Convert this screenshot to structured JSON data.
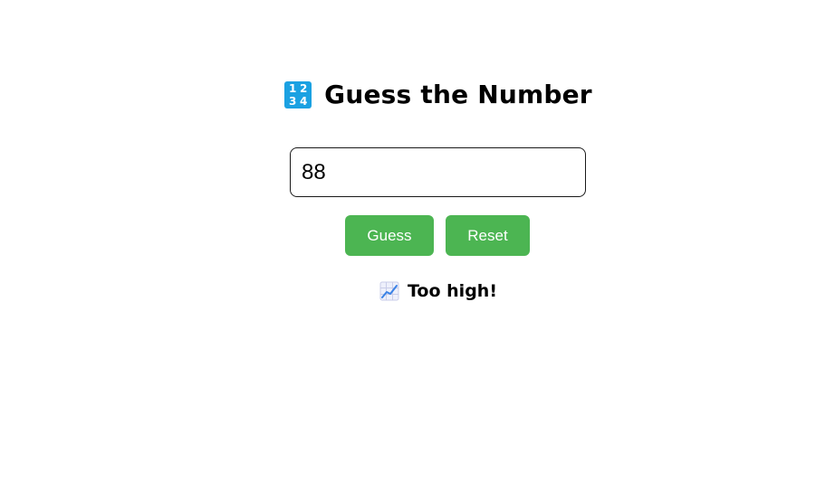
{
  "header": {
    "title": "Guess the Number",
    "icon": "input-numbers-icon",
    "icon_digits": [
      "1",
      "2",
      "3",
      "4"
    ],
    "icon_color": "#1ba1e2"
  },
  "input": {
    "value": "88",
    "placeholder": ""
  },
  "buttons": {
    "guess_label": "Guess",
    "reset_label": "Reset",
    "color": "#4cb552"
  },
  "result": {
    "icon": "chart-increasing-icon",
    "text": "Too high!"
  }
}
